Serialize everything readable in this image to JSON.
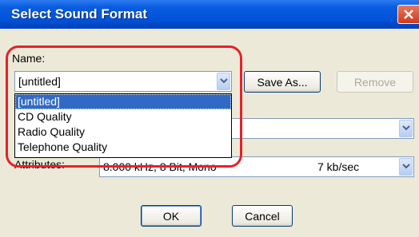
{
  "window": {
    "title": "Select Sound Format"
  },
  "name_field": {
    "label": "Name:",
    "value": "[untitled]",
    "options": [
      "[untitled]",
      "CD Quality",
      "Radio Quality",
      "Telephone Quality"
    ],
    "selected_index": 0
  },
  "buttons": {
    "save_as": "Save As...",
    "remove": "Remove",
    "ok": "OK",
    "cancel": "Cancel"
  },
  "attributes": {
    "label": "Attributes:",
    "value": "8.000 kHz, 8 Bit, Mono",
    "rate": "7 kb/sec"
  },
  "colors": {
    "titlebar": "#0052d8",
    "selection": "#316ac5",
    "annotation": "#e8202a"
  }
}
